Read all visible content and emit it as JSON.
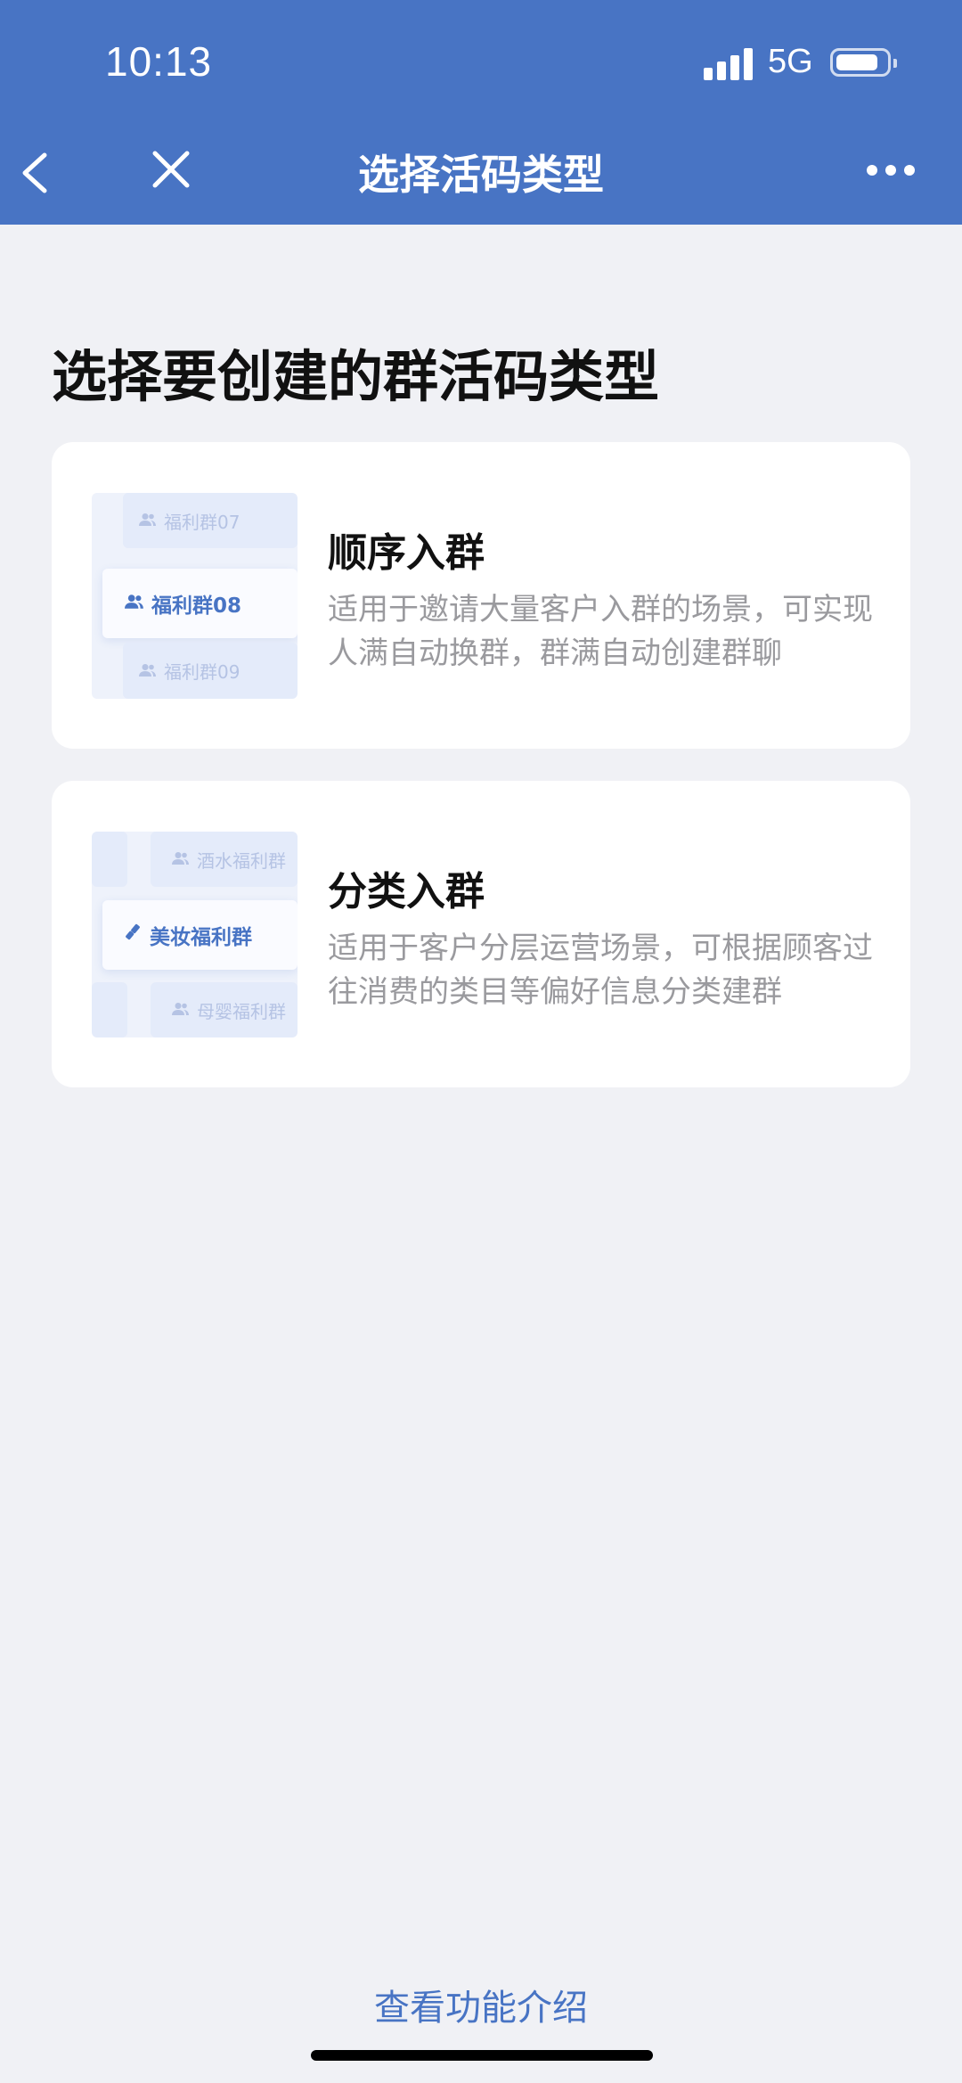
{
  "status_bar": {
    "time": "10:13",
    "network": "5G"
  },
  "nav": {
    "title": "选择活码类型",
    "back_icon": "chevron-left-icon",
    "close_icon": "close-icon",
    "more_icon": "more-dots-icon"
  },
  "page": {
    "heading": "选择要创建的群活码类型"
  },
  "cards": [
    {
      "title": "顺序入群",
      "description": "适用于邀请大量客户入群的场景，可实现人满自动换群，群满自动创建群聊",
      "illustration": {
        "top": "福利群07",
        "middle": "福利群08",
        "bottom": "福利群09"
      }
    },
    {
      "title": "分类入群",
      "description": "适用于客户分层运营场景，可根据顾客过往消费的类目等偏好信息分类建群",
      "illustration": {
        "top": "酒水福利群",
        "middle": "美妆福利群",
        "bottom": "母婴福利群"
      }
    }
  ],
  "footer": {
    "link": "查看功能介绍"
  },
  "colors": {
    "primary": "#4874c4",
    "background": "#f0f1f5",
    "card": "#ffffff",
    "text_secondary": "#9a9a9e"
  }
}
